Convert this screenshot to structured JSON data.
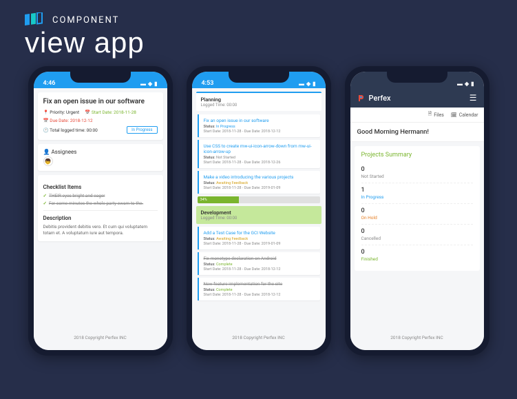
{
  "header": {
    "brand": "COMPONENT",
    "title": "view app"
  },
  "phone1": {
    "time": "4:46",
    "task_title": "Fix an open issue in our software",
    "priority_label": "Priority: Urgent",
    "start_date": "Start Date: 2018-11-28",
    "due_date": "Due Date: 2018-12-12",
    "logged": "Total logged time: 00:00",
    "status_badge": "In Progress",
    "assignees_title": "Assignees",
    "checklist_title": "Checklist Items",
    "checklist": [
      "THEIR eyes bright and eager",
      "For some minutes the whole party swam to the."
    ],
    "description_title": "Description",
    "description": "Debitis provident debitis vero. Et cum qui voluptatem totam et. A voluptatum iure aut tempora."
  },
  "phone2": {
    "time": "4:53",
    "planning": {
      "name": "Planning",
      "logged": "Logged Time: 00:00"
    },
    "tasks1": [
      {
        "title": "Fix an open issue in our software",
        "status": "In Progress",
        "status_cls": "status-inprog",
        "dates": "Start Date: 2018-11-28 - Due Date: 2018-12-12"
      },
      {
        "title": "Use CSS to create mw-ui-icon-arrow-down from mw-ui-icon-arrow-up",
        "status": "Not Started",
        "status_cls": "status-notstart",
        "dates": "Start Date: 2018-11-28 - Due Date: 2018-12-26"
      },
      {
        "title": "Make a video introducing the various projects",
        "status": "Awaiting Feedback",
        "status_cls": "status-awaiting",
        "dates": "Start Date: 2018-11-28 - Due Date: 2019-01-09"
      }
    ],
    "progress": "34%",
    "development": {
      "name": "Development",
      "logged": "Logged Time: 00:00"
    },
    "tasks2": [
      {
        "title": "Add a Test Case for the GCI Website",
        "status": "Awaiting Feedback",
        "status_cls": "status-awaiting",
        "dates": "Start Date: 2018-11-28 - Due Date: 2019-01-09",
        "strike": false
      },
      {
        "title": "Fix monotype declaration on Android",
        "status": "Complete",
        "status_cls": "status-complete",
        "dates": "Start Date: 2018-11-28 - Due Date: 2018-12-12",
        "strike": true
      },
      {
        "title": "New feature implementation for the site",
        "status": "Complete",
        "status_cls": "status-complete",
        "dates": "Start Date: 2018-11-28 - Due Date: 2018-12-12",
        "strike": true
      }
    ]
  },
  "phone3": {
    "app_name": "Perfex",
    "files": "Files",
    "calendar": "Calendar",
    "greeting": "Good Morning Hermann!",
    "summary_title": "Projects Summary",
    "items": [
      {
        "count": "0",
        "label": "Not Started",
        "cls": "lbl-notstart"
      },
      {
        "count": "1",
        "label": "In Progress",
        "cls": "lbl-inprog"
      },
      {
        "count": "0",
        "label": "On Hold",
        "cls": "lbl-onhold"
      },
      {
        "count": "0",
        "label": "Cancelled",
        "cls": "lbl-cancelled"
      },
      {
        "count": "0",
        "label": "Finished",
        "cls": "lbl-finished"
      }
    ]
  },
  "footer": "2018 Copyright Perfex INC"
}
